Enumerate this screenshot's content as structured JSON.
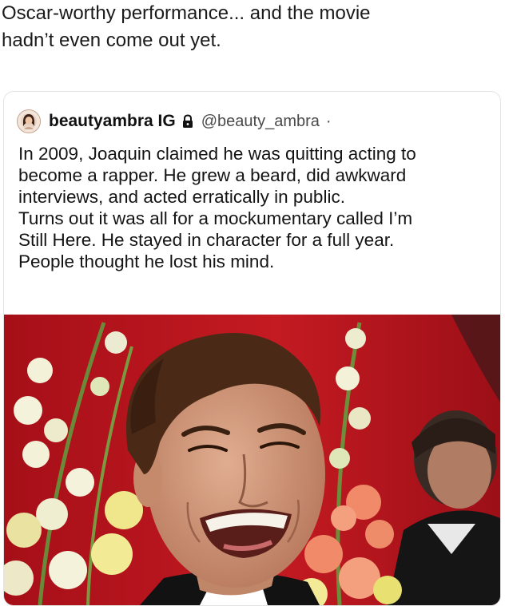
{
  "post": {
    "caption_lines": [
      "Oscar-worthy performance... and the movie",
      "hadn’t even come out yet."
    ]
  },
  "tweet": {
    "display_name": "beautyambra IG",
    "handle": "@beauty_ambra",
    "separator": "·",
    "text_lines": [
      "In 2009, Joaquin claimed he was quitting acting to",
      "become a rapper. He grew a beard, did awkward",
      "interviews, and acted erratically in public.",
      "Turns out it was all for a mockumentary called I’m",
      "Still Here. He stayed in character for a full year.",
      "People thought he lost his mind."
    ],
    "icons": {
      "avatar": "avatar-icon",
      "lock": "lock-icon"
    }
  },
  "photo": {
    "subject": "man-laughing-red-carpet",
    "colors": {
      "backdrop": "#c0151f",
      "skin": "#d39a7e",
      "hair": "#4a2a17",
      "flowers": "#f3f1d8"
    }
  }
}
